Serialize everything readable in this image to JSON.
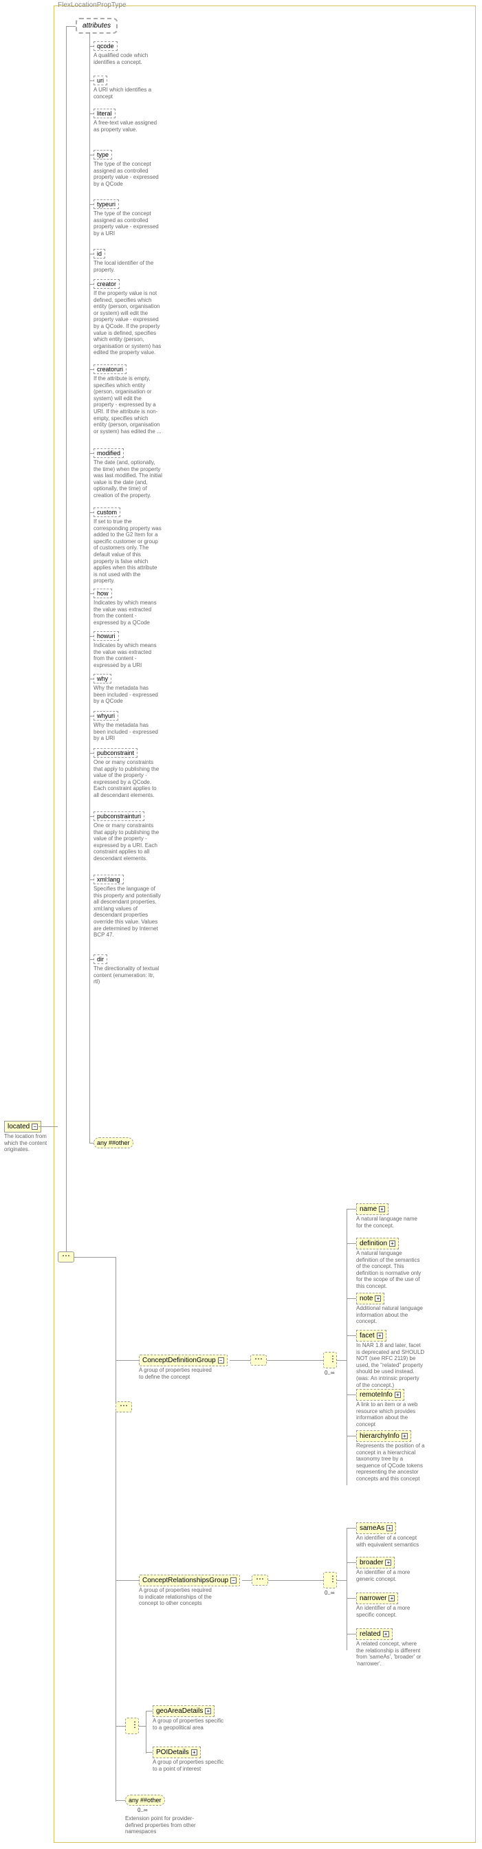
{
  "typeLabel": "FlexLocationPropType",
  "rootElem": "located",
  "rootDesc": "The location from which the content originates.",
  "attrLabel": "attributes",
  "attrs": [
    {
      "name": "qcode",
      "desc": "A qualified code which identifies a concept."
    },
    {
      "name": "uri",
      "desc": "A URI which identifies a concept"
    },
    {
      "name": "literal",
      "desc": "A free-text value assigned as property value."
    },
    {
      "name": "type",
      "desc": "The type of the concept assigned as controlled property value - expressed by a QCode"
    },
    {
      "name": "typeuri",
      "desc": "The type of the concept assigned as controlled property value - expressed by a URI"
    },
    {
      "name": "id",
      "desc": "The local identifier of the property."
    },
    {
      "name": "creator",
      "desc": "If the property value is not defined, specifies which entity (person, organisation or system) will edit the property value - expressed by a QCode. If the property value is defined, specifies which entity (person, organisation or system) has edited the property value."
    },
    {
      "name": "creatoruri",
      "desc": "If the attribute is empty, specifies which entity (person, organisation or system) will edit the property - expressed by a URI. If the attribute is non-empty, specifies which entity (person, organisation or system) has edited the ..."
    },
    {
      "name": "modified",
      "desc": "The date (and, optionally, the time) when the property was last modified. The initial value is the date (and, optionally, the time) of creation of the property."
    },
    {
      "name": "custom",
      "desc": "If set to true the corresponding property was added to the G2 Item for a specific customer or group of customers only. The default value of this property is false which applies when this attribute is not used with the property."
    },
    {
      "name": "how",
      "desc": "Indicates by which means the value was extracted from the content - expressed by a QCode"
    },
    {
      "name": "howuri",
      "desc": "Indicates by which means the value was extracted from the content - expressed by a URI"
    },
    {
      "name": "why",
      "desc": "Why the metadata has been included - expressed by a QCode"
    },
    {
      "name": "whyuri",
      "desc": "Why the metadata has been included - expressed by a URI"
    },
    {
      "name": "pubconstraint",
      "desc": "One or many constraints that apply to publishing the value of the property - expressed by a QCode. Each constraint applies to all descendant elements."
    },
    {
      "name": "pubconstrainturi",
      "desc": "One or many constraints that apply to publishing the value of the property - expressed by a URI. Each constraint applies to all descendant elements."
    },
    {
      "name": "xml:lang",
      "desc": "Specifies the language of this property and potentially all descendant properties. xml:lang values of descendant properties override this value. Values are determined by Internet BCP 47."
    },
    {
      "name": "dir",
      "desc": "The directionality of textual content (enumeration: ltr, rtl)"
    }
  ],
  "anyAttr": "any ##other",
  "groups": {
    "def": {
      "name": "ConceptDefinitionGroup",
      "desc": "A group of properties required to define the concept"
    },
    "rel": {
      "name": "ConceptRelationshipsGroup",
      "desc": "A group of properties required to indicate relationships of the concept to other concepts"
    },
    "geo": {
      "name": "geoAreaDetails",
      "desc": "A group of properties specific to a geopolitical area"
    },
    "poi": {
      "name": "POIDetails",
      "desc": "A group of properties specific to a point of interest"
    }
  },
  "defItems": [
    {
      "name": "name",
      "desc": "A natural language name for the concept."
    },
    {
      "name": "definition",
      "desc": "A natural language definition of the semantics of the concept. This definition is normative only for the scope of the use of this concept."
    },
    {
      "name": "note",
      "desc": "Additional natural language information about the concept."
    },
    {
      "name": "facet",
      "desc": "In NAR 1.8 and later, facet is deprecated and SHOULD NOT (see RFC 2119) be used, the \"related\" property should be used instead.(was: An intrinsic property of the concept.)"
    },
    {
      "name": "remoteInfo",
      "desc": "A link to an item or a web resource which provides information about the concept"
    },
    {
      "name": "hierarchyInfo",
      "desc": "Represents the position of a concept in a hierarchical taxonomy tree by a sequence of QCode tokens representing the ancestor concepts and this concept"
    }
  ],
  "relItems": [
    {
      "name": "sameAs",
      "desc": "An identifier of a concept with equivalent semantics"
    },
    {
      "name": "broader",
      "desc": "An identifier of a more generic concept."
    },
    {
      "name": "narrower",
      "desc": "An identifier of a more specific concept."
    },
    {
      "name": "related",
      "desc": "A related concept, where the relationship is different from 'sameAs', 'broader' or 'narrower'."
    }
  ],
  "anyOther": {
    "name": "any ##other",
    "desc": "Extension point for provider-defined properties from other namespaces"
  },
  "occ": "0..∞"
}
